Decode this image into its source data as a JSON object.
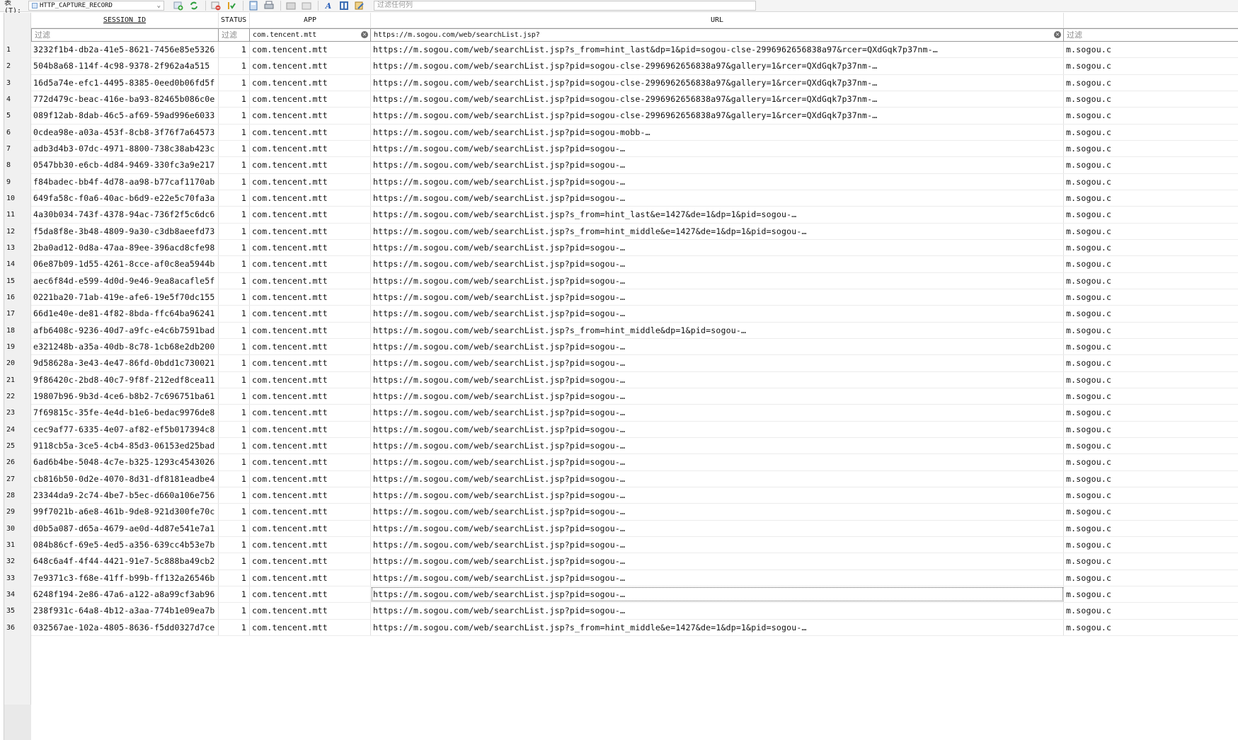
{
  "toolbar": {
    "table_label": "表(T):",
    "table_select_value": "HTTP_CAPTURE_RECORD",
    "column_filter_placeholder": "过滤任何列"
  },
  "columns": {
    "session_id": "SESSION ID",
    "status": "STATUS",
    "app": "APP",
    "url": "URL"
  },
  "filters": {
    "session_id_placeholder": "过滤",
    "status_placeholder": "过滤",
    "app_value": "com.tencent.mtt",
    "url_value": "https://m.sogou.com/web/searchList.jsp?",
    "host_placeholder": "过滤"
  },
  "rows": [
    {
      "num": "1",
      "sid": "3232f1b4-db2a-41e5-8621-7456e85e5326",
      "status": "1",
      "app": "com.tencent.mtt",
      "url": "https://m.sogou.com/web/searchList.jsp?s_from=hint_last&dp=1&pid=sogou-clse-2996962656838a97&rcer=QXdGqk7p37nm-…",
      "host": "m.sogou.c"
    },
    {
      "num": "2",
      "sid": "504b8a68-114f-4c98-9378-2f962a4a515",
      "status": "1",
      "app": "com.tencent.mtt",
      "url": "https://m.sogou.com/web/searchList.jsp?pid=sogou-clse-2996962656838a97&gallery=1&rcer=QXdGqk7p37nm-…",
      "host": "m.sogou.c"
    },
    {
      "num": "3",
      "sid": "16d5a74e-efc1-4495-8385-0eed0b06fd5f",
      "status": "1",
      "app": "com.tencent.mtt",
      "url": "https://m.sogou.com/web/searchList.jsp?pid=sogou-clse-2996962656838a97&gallery=1&rcer=QXdGqk7p37nm-…",
      "host": "m.sogou.c"
    },
    {
      "num": "4",
      "sid": "772d479c-beac-416e-ba93-82465b086c0e",
      "status": "1",
      "app": "com.tencent.mtt",
      "url": "https://m.sogou.com/web/searchList.jsp?pid=sogou-clse-2996962656838a97&gallery=1&rcer=QXdGqk7p37nm-…",
      "host": "m.sogou.c"
    },
    {
      "num": "5",
      "sid": "089f12ab-8dab-46c5-af69-59ad996e6033",
      "status": "1",
      "app": "com.tencent.mtt",
      "url": "https://m.sogou.com/web/searchList.jsp?pid=sogou-clse-2996962656838a97&gallery=1&rcer=QXdGqk7p37nm-…",
      "host": "m.sogou.c"
    },
    {
      "num": "6",
      "sid": "0cdea98e-a03a-453f-8cb8-3f76f7a64573",
      "status": "1",
      "app": "com.tencent.mtt",
      "url": "https://m.sogou.com/web/searchList.jsp?pid=sogou-mobb-…",
      "host": "m.sogou.c"
    },
    {
      "num": "7",
      "sid": "adb3d4b3-07dc-4971-8800-738c38ab423c",
      "status": "1",
      "app": "com.tencent.mtt",
      "url": "https://m.sogou.com/web/searchList.jsp?pid=sogou-…",
      "host": "m.sogou.c"
    },
    {
      "num": "8",
      "sid": "0547bb30-e6cb-4d84-9469-330fc3a9e217",
      "status": "1",
      "app": "com.tencent.mtt",
      "url": "https://m.sogou.com/web/searchList.jsp?pid=sogou-…",
      "host": "m.sogou.c"
    },
    {
      "num": "9",
      "sid": "f84badec-bb4f-4d78-aa98-b77caf1170ab",
      "status": "1",
      "app": "com.tencent.mtt",
      "url": "https://m.sogou.com/web/searchList.jsp?pid=sogou-…",
      "host": "m.sogou.c"
    },
    {
      "num": "10",
      "sid": "649fa58c-f0a6-40ac-b6d9-e22e5c70fa3a",
      "status": "1",
      "app": "com.tencent.mtt",
      "url": "https://m.sogou.com/web/searchList.jsp?pid=sogou-…",
      "host": "m.sogou.c"
    },
    {
      "num": "11",
      "sid": "4a30b034-743f-4378-94ac-736f2f5c6dc6",
      "status": "1",
      "app": "com.tencent.mtt",
      "url": "https://m.sogou.com/web/searchList.jsp?s_from=hint_last&e=1427&de=1&dp=1&pid=sogou-…",
      "host": "m.sogou.c"
    },
    {
      "num": "12",
      "sid": "f5da8f8e-3b48-4809-9a30-c3db8aeefd73",
      "status": "1",
      "app": "com.tencent.mtt",
      "url": "https://m.sogou.com/web/searchList.jsp?s_from=hint_middle&e=1427&de=1&dp=1&pid=sogou-…",
      "host": "m.sogou.c"
    },
    {
      "num": "13",
      "sid": "2ba0ad12-0d8a-47aa-89ee-396acd8cfe98",
      "status": "1",
      "app": "com.tencent.mtt",
      "url": "https://m.sogou.com/web/searchList.jsp?pid=sogou-…",
      "host": "m.sogou.c"
    },
    {
      "num": "14",
      "sid": "06e87b09-1d55-4261-8cce-af0c8ea5944b",
      "status": "1",
      "app": "com.tencent.mtt",
      "url": "https://m.sogou.com/web/searchList.jsp?pid=sogou-…",
      "host": "m.sogou.c"
    },
    {
      "num": "15",
      "sid": "aec6f84d-e599-4d0d-9e46-9ea8acafle5f",
      "status": "1",
      "app": "com.tencent.mtt",
      "url": "https://m.sogou.com/web/searchList.jsp?pid=sogou-…",
      "host": "m.sogou.c"
    },
    {
      "num": "16",
      "sid": "0221ba20-71ab-419e-afe6-19e5f70dc155",
      "status": "1",
      "app": "com.tencent.mtt",
      "url": "https://m.sogou.com/web/searchList.jsp?pid=sogou-…",
      "host": "m.sogou.c"
    },
    {
      "num": "17",
      "sid": "66d1e40e-de81-4f82-8bda-ffc64ba96241",
      "status": "1",
      "app": "com.tencent.mtt",
      "url": "https://m.sogou.com/web/searchList.jsp?pid=sogou-…",
      "host": "m.sogou.c"
    },
    {
      "num": "18",
      "sid": "afb6408c-9236-40d7-a9fc-e4c6b7591bad",
      "status": "1",
      "app": "com.tencent.mtt",
      "url": "https://m.sogou.com/web/searchList.jsp?s_from=hint_middle&dp=1&pid=sogou-…",
      "host": "m.sogou.c"
    },
    {
      "num": "19",
      "sid": "e321248b-a35a-40db-8c78-1cb68e2db200",
      "status": "1",
      "app": "com.tencent.mtt",
      "url": "https://m.sogou.com/web/searchList.jsp?pid=sogou-…",
      "host": "m.sogou.c"
    },
    {
      "num": "20",
      "sid": "9d58628a-3e43-4e47-86fd-0bdd1c730021",
      "status": "1",
      "app": "com.tencent.mtt",
      "url": "https://m.sogou.com/web/searchList.jsp?pid=sogou-…",
      "host": "m.sogou.c"
    },
    {
      "num": "21",
      "sid": "9f86420c-2bd8-40c7-9f8f-212edf8cea11",
      "status": "1",
      "app": "com.tencent.mtt",
      "url": "https://m.sogou.com/web/searchList.jsp?pid=sogou-…",
      "host": "m.sogou.c"
    },
    {
      "num": "22",
      "sid": "19807b96-9b3d-4ce6-b8b2-7c696751ba61",
      "status": "1",
      "app": "com.tencent.mtt",
      "url": "https://m.sogou.com/web/searchList.jsp?pid=sogou-…",
      "host": "m.sogou.c"
    },
    {
      "num": "23",
      "sid": "7f69815c-35fe-4e4d-b1e6-bedac9976de8",
      "status": "1",
      "app": "com.tencent.mtt",
      "url": "https://m.sogou.com/web/searchList.jsp?pid=sogou-…",
      "host": "m.sogou.c"
    },
    {
      "num": "24",
      "sid": "cec9af77-6335-4e07-af82-ef5b017394c8",
      "status": "1",
      "app": "com.tencent.mtt",
      "url": "https://m.sogou.com/web/searchList.jsp?pid=sogou-…",
      "host": "m.sogou.c"
    },
    {
      "num": "25",
      "sid": "9118cb5a-3ce5-4cb4-85d3-06153ed25bad",
      "status": "1",
      "app": "com.tencent.mtt",
      "url": "https://m.sogou.com/web/searchList.jsp?pid=sogou-…",
      "host": "m.sogou.c"
    },
    {
      "num": "26",
      "sid": "6ad6b4be-5048-4c7e-b325-1293c4543026",
      "status": "1",
      "app": "com.tencent.mtt",
      "url": "https://m.sogou.com/web/searchList.jsp?pid=sogou-…",
      "host": "m.sogou.c"
    },
    {
      "num": "27",
      "sid": "cb816b50-0d2e-4070-8d31-df8181eadbe4",
      "status": "1",
      "app": "com.tencent.mtt",
      "url": "https://m.sogou.com/web/searchList.jsp?pid=sogou-…",
      "host": "m.sogou.c"
    },
    {
      "num": "28",
      "sid": "23344da9-2c74-4be7-b5ec-d660a106e756",
      "status": "1",
      "app": "com.tencent.mtt",
      "url": "https://m.sogou.com/web/searchList.jsp?pid=sogou-…",
      "host": "m.sogou.c"
    },
    {
      "num": "29",
      "sid": "99f7021b-a6e8-461b-9de8-921d300fe70c",
      "status": "1",
      "app": "com.tencent.mtt",
      "url": "https://m.sogou.com/web/searchList.jsp?pid=sogou-…",
      "host": "m.sogou.c"
    },
    {
      "num": "30",
      "sid": "d0b5a087-d65a-4679-ae0d-4d87e541e7a1",
      "status": "1",
      "app": "com.tencent.mtt",
      "url": "https://m.sogou.com/web/searchList.jsp?pid=sogou-…",
      "host": "m.sogou.c"
    },
    {
      "num": "31",
      "sid": "084b86cf-69e5-4ed5-a356-639cc4b53e7b",
      "status": "1",
      "app": "com.tencent.mtt",
      "url": "https://m.sogou.com/web/searchList.jsp?pid=sogou-…",
      "host": "m.sogou.c"
    },
    {
      "num": "32",
      "sid": "648c6a4f-4f44-4421-91e7-5c888ba49cb2",
      "status": "1",
      "app": "com.tencent.mtt",
      "url": "https://m.sogou.com/web/searchList.jsp?pid=sogou-…",
      "host": "m.sogou.c"
    },
    {
      "num": "33",
      "sid": "7e9371c3-f68e-41ff-b99b-ff132a26546b",
      "status": "1",
      "app": "com.tencent.mtt",
      "url": "https://m.sogou.com/web/searchList.jsp?pid=sogou-…",
      "host": "m.sogou.c"
    },
    {
      "num": "34",
      "sid": "6248f194-2e86-47a6-a122-a8a99cf3ab96",
      "status": "1",
      "app": "com.tencent.mtt",
      "url": "https://m.sogou.com/web/searchList.jsp?pid=sogou-…",
      "host": "m.sogou.c"
    },
    {
      "num": "35",
      "sid": "238f931c-64a8-4b12-a3aa-774b1e09ea7b",
      "status": "1",
      "app": "com.tencent.mtt",
      "url": "https://m.sogou.com/web/searchList.jsp?pid=sogou-…",
      "host": "m.sogou.c"
    },
    {
      "num": "36",
      "sid": "032567ae-102a-4805-8636-f5dd0327d7ce",
      "status": "1",
      "app": "com.tencent.mtt",
      "url": "https://m.sogou.com/web/searchList.jsp?s_from=hint_middle&e=1427&de=1&dp=1&pid=sogou-…",
      "host": "m.sogou.c"
    }
  ],
  "icons": {
    "toolbar": [
      "add-row-icon",
      "refresh-icon",
      "delete-row-icon",
      "apply-icon",
      "save-icon",
      "print-icon",
      "export-icon",
      "import-icon",
      "font-icon",
      "column-chooser-icon",
      "edit-icon"
    ]
  }
}
